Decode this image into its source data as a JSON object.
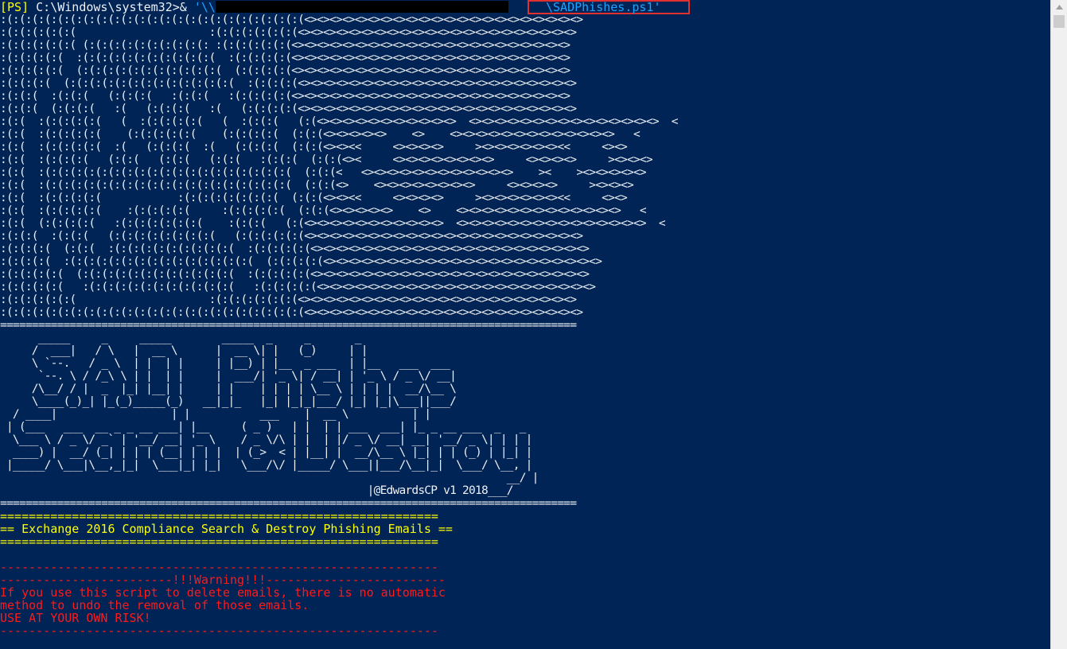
{
  "prompt": {
    "tag": "[PS]",
    "path": " C:\\Windows\\system32>& ",
    "quote_prefix": "'\\\\",
    "script_name": "\\SADPhishes.ps1'"
  },
  "art_lines": [
    ":(:(:(:(:(:(:(:(:(:(:(:(:(:(:(:(:(:(:(:(:(:(:(:(<><><><><><><><><><><><><><><><><><><><><><>",
    ":(:(:(:(:(:(                     :(:(:(:(:(:(:(<><><><><><><><><><><><><><><><><><><><><><>",
    ":(:(:(:(:(:( (:(:(:(:(:(:(:(:(:(: :(:(:(:(:(:(<><><><><><><><><><><><><><><><><><><><><><>",
    ":(:(:(:(:(  :(:(:(:(:(:(:(:(:(:(:(  :(:(:(:(:(<><><><><><><><><><><><><><><><><><><><><><>",
    ":(:(:(:(:(  (:(:(:(:(:(:(:(:(:(:(:(  (:(:(:(:(<><><><><><><><><><><><><><><><><><><><><><>",
    ":(:(:(:(  (:(:(:(:(:(:(:(:(:(:(:(:(:(  :(:(:(:(<><><><><><><><><><><><><><><><><><><><><><>",
    ":(:(:(  :(:(:(   (:(:(:(   :(:(:(   :(:(:(:(:(<><><><><><><><><><><><><><><><><><><><><><>",
    ":(:(:(  (:(:(:(   :(   (:(:(:(   :(   (:(:(:(:(<><><><><><><><><><><><><><><><><><><><><><>",
    ":(:(  :(:(:(:(:(   (  :(:(:(:(:(   (  :(:(:(   (:(<><><><><><><><><><><>  <><><><><><><><><><><><><><><>  <",
    ":(:(  :(:(:(:(:(    (:(:(:(:(:(    (:(:(:(:(  (:(:(<><><><><>    <>    <><><><><><><><><><><><><>   <",
    ":(:(  :(:(:(:(:(  :(   (:(:(:(  :(   (:(:(:(  (:(:(<><><<     <><><><>     ><><><><><><><<     <><>",
    ":(:(  :(:(:(:(   (:(:(   (:(:(   (:(:(   :(:(:(  (:(:(<><     <><><><><><><><>     <><><><>     ><><><>",
    ":(:(  :(:(:(:(:(:(:(:(:(:(:(:(:(:(:(:(:(:(:(:(  (:(:(<   <><><><><><><><><><><><>    ><    ><><><><><>",
    ":(:(  :(:(:(:(:(:(:(:(:(:(:(:(:(:(:(:(:(:(:(:(  (:(:(<>    <><><><><><><><>     <><><><>     ><><><>",
    ":(:(  :(:(:(:(:(            :(:(:(:(:(:(:(:(  (:(:(<><><<     <><><><>     ><><><><><><><<     <><>",
    ":(:(  :(:(:(:(:(    :(:(:(:(:(     :(:(:(:(:(  (:(:(<><><><><>    <>    <><><><><><><><><><><><><>   <",
    ":(:(  (:(:(:(:(   :(:(:(:(:(:(:(    :(:(:(   (:(<><><><><><><><><><><>  <><><><><><><><><><><><><><><>  <",
    ":(:(:(  :(:(:(   (:(:(:(:(:(:(:(:(   (:(:(:(:(:(<><><><><><><><><><><><><><><><><><><><><><>",
    ":(:(:(:(  (:(:(  :(:(:(:(:(:(:(:(:(:(  :(:(:(:(:(<><><><><><><><><><><><><><><><><><><><><><>",
    ":(:(:(:(  :(:(:(:(:(:(:(:(:(:(:(:(:(:(:(  (:(:(:(:(<><><><><><><><><><><><><><><><><><><><><><>",
    ":(:(:(:(:(  (:(:(:(:(:(:(:(:(:(:(:(:(  :(:(:(:(:(<><><><><><><><><><><><><><><><><><><><><><>",
    ":(:(:(:(:(   :(:(:(:(:(:(:(:(:(:(:(:(   :(:(:(:(:(<><><><><><><><><><><><><><><><><><><><><><>",
    ":(:(:(:(:(:(                     :(:(:(:(:(:(:(<><><><><><><><><><><><><><><><><><><><><><>",
    ":(:(:(:(:(:(:(:(:(:(:(:(:(:(:(:(:(:(:(:(:(:(:(:(<><><><><><><><><><><><><><><><><><><><><><>"
  ],
  "separator": "===========================================================================================",
  "title_art": [
    "      _____     _     _____        _____  _     _       _",
    "     /  ___|   / \\   |  __ \\      |  __ \\| |   (_)     | |",
    "     \\ `--.   / _ \\  | |  | |     | |__) | |__  _ ___  | |__   ___  ___",
    "      `--. \\ / /_\\ \\ | |  | |     |  ___/| '_ \\| / __| | '_ \\ / _ \\/ __|",
    "     /\\__/ / |  _  |_| |__| |     | |    | | | | \\__ \\ | | | |  __/\\__ \\",
    "     \\____(_)_| |_(_)_____(_)   __|_|_   |_| |_|_|___/ |_| |_|\\___||___/",
    "  / ____|                  | |           ___    |  __ \\          | |",
    " | (___   ___  __ _ _ __ ___| |__     ( _ )   | |  | | ___  ___| |_ _ __ ___  _   _",
    "  \\___ \\ / _ \\/ _` | '__/ __| '_ \\    / _ \\/\\ | |  | |/ _ \\/ __| __| '__/ _ \\| | | |",
    "  ____) |  __/ (_| | | | (__| | | |  | (_>  < | |__| |  __/\\__ \\ |_| | | (_) | |_| |",
    " |_____/ \\___|\\__,_|_|  \\___|_| |_|   \\___/\\/ |_____/ \\___||___/\\__|_|  \\___/ \\__, |",
    "                                                                                __/ |",
    "                                                          |@EdwardsCP v1 2018___/"
  ],
  "banner": {
    "rule": "=============================================================",
    "title": "== Exchange 2016 Compliance Search & Destroy Phishing Emails =="
  },
  "warning": {
    "rule": "-------------------------------------------------------------",
    "header": "------------------------!!!Warning!!!-------------------------",
    "line1": "If you use this script to delete emails, there is no automatic",
    "line2": "method to undo the removal of those emails.",
    "line3": "USE AT YOUR OWN RISK!"
  },
  "colors": {
    "background": "#012456",
    "prompt_tag": "#ffff00",
    "text": "#eef0f2",
    "string": "#1ea2ff",
    "banner": "#ffff00",
    "warning": "#ff1a1a",
    "highlight_border": "#e03030"
  }
}
